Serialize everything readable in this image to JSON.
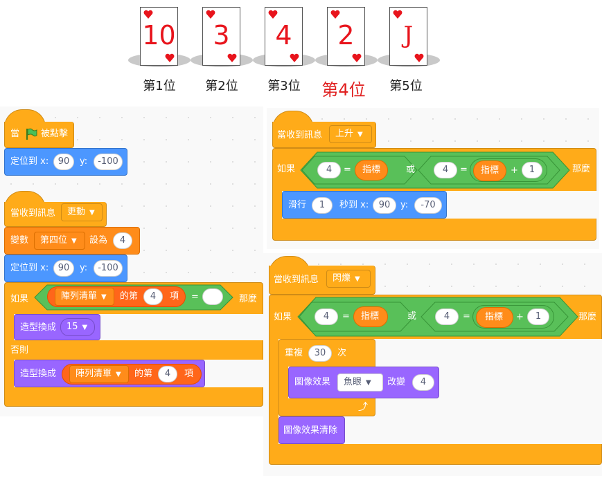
{
  "cards": [
    {
      "value": "10",
      "label": "第1位"
    },
    {
      "value": "3",
      "label": "第2位"
    },
    {
      "value": "4",
      "label": "第3位"
    },
    {
      "value": "2",
      "label": "第4位"
    },
    {
      "value": "J",
      "label": "第5位"
    }
  ],
  "colors": {
    "card_red": "#e8141c",
    "event": "#ffab19",
    "motion": "#4c97ff",
    "variable": "#ff8c1a",
    "looks": "#9966ff",
    "operator": "#59c059",
    "highlight_label": "#e02020"
  },
  "script1": {
    "when": "當",
    "flag_icon": "green-flag-icon",
    "clicked": "被點擊",
    "goto": "定位到 x:",
    "x": "90",
    "y_label": "y:",
    "y": "-100"
  },
  "script2": {
    "hat": "當收到訊息",
    "message": "更動",
    "set": "變數",
    "var": "第四位",
    "to": "設為",
    "set_val": "4",
    "goto": "定位到 x:",
    "x": "90",
    "y_label": "y:",
    "y": "-100",
    "if": "如果",
    "list": "陣列清單",
    "item_of": "的第",
    "item_idx": "4",
    "item_word": "項",
    "eq": "=",
    "then": "那麼",
    "costume": "造型換成",
    "costume_val": "15",
    "else": "否則",
    "costume2": "造型換成",
    "list2": "陣列清單",
    "item_of2": "的第",
    "item_idx2": "4",
    "item_word2": "項"
  },
  "script3": {
    "hat": "當收到訊息",
    "message": "上升",
    "if": "如果",
    "left_num": "4",
    "eq": "=",
    "pointer": "指標",
    "or": "或",
    "num2": "4",
    "eq2": "=",
    "pointer2": "指標",
    "plus": "+",
    "add": "1",
    "then": "那麼",
    "glide": "滑行",
    "secs": "1",
    "secs_to": "秒到 x:",
    "x": "90",
    "y_label": "y:",
    "y": "-70"
  },
  "script4": {
    "hat": "當收到訊息",
    "message": "閃爍",
    "if": "如果",
    "left_num": "4",
    "eq": "=",
    "pointer": "指標",
    "or": "或",
    "num2": "4",
    "eq2": "=",
    "pointer2": "指標",
    "plus": "+",
    "add": "1",
    "then": "那麼",
    "repeat": "重複",
    "times": "30",
    "times_word": "次",
    "effect": "圖像效果",
    "effect_name": "魚眼",
    "change": "改變",
    "change_val": "4",
    "clear": "圖像效果清除"
  }
}
